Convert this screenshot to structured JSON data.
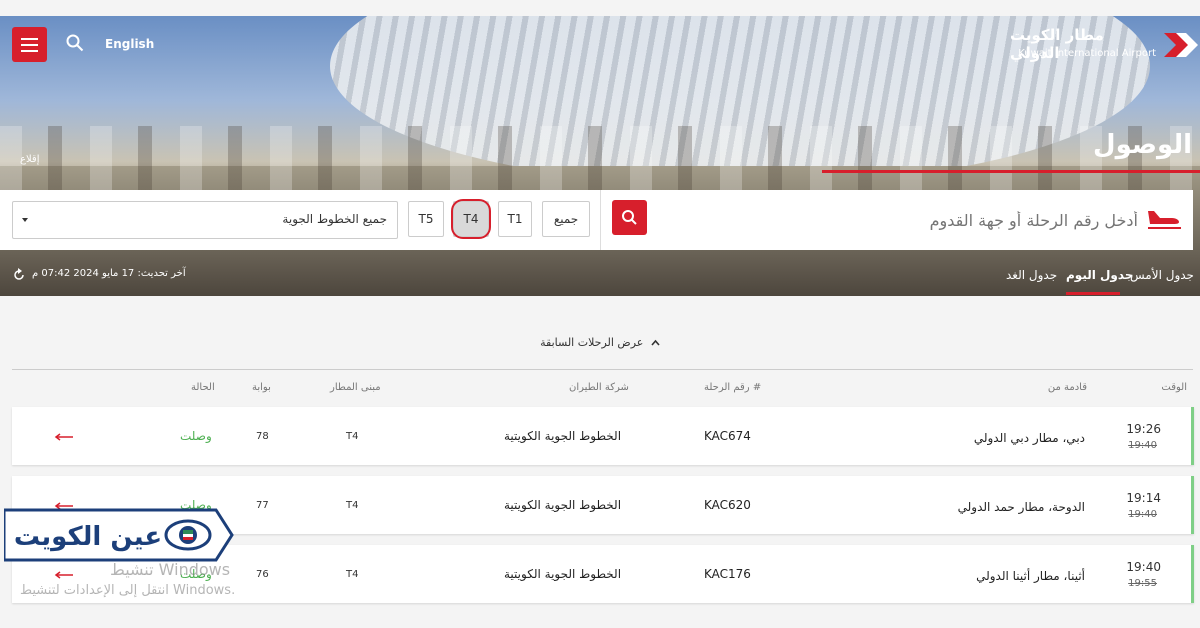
{
  "header": {
    "lang": "English",
    "logo_ar": "مطار الكويت الدولي",
    "logo_en": "Kuwait International Airport",
    "hero_tag": "إقلاع"
  },
  "page": {
    "title": "الوصول"
  },
  "search": {
    "placeholder": "أدخل رقم الرحلة أو جهة القدوم",
    "airline": "جميع الخطوط الجوية",
    "terminals": [
      "T5",
      "T4",
      "T1",
      "جميع"
    ],
    "selected": "T4"
  },
  "tabs": {
    "yesterday": "جدول الأمس",
    "today": "جدول اليوم",
    "tomorrow": "جدول الغد"
  },
  "update": "آخر تحديث: 17 مايو 2024 07:42 م",
  "prev": "عرض الرحلات السابقة",
  "columns": {
    "time": "الوقت",
    "from": "قادمة من",
    "flight": "رقم الرحلة #",
    "airline": "شركة الطيران",
    "terminal": "مبنى المطار",
    "gate": "بوابة",
    "status": "الحالة"
  },
  "flights": [
    {
      "time": "19:26",
      "sched": "19:40",
      "from": "دبي، مطار دبي الدولي",
      "flight": "KAC674",
      "airline": "الخطوط الجوية الكويتية",
      "terminal": "T4",
      "gate": "78",
      "status": "وصلت"
    },
    {
      "time": "19:14",
      "sched": "19:40",
      "from": "الدوحة، مطار حمد الدولي",
      "flight": "KAC620",
      "airline": "الخطوط الجوية الكويتية",
      "terminal": "T4",
      "gate": "77",
      "status": "وصلت"
    },
    {
      "time": "19:40",
      "sched": "19:55",
      "from": "أثينا، مطار أثينا الدولي",
      "flight": "KAC176",
      "airline": "الخطوط الجوية الكويتية",
      "terminal": "T4",
      "gate": "76",
      "status": "وصلت"
    }
  ],
  "watermark": {
    "logo_text": "عين الكويت",
    "activate_title": "تنشيط Windows",
    "activate_sub": "انتقل إلى الإعدادات لتنشيط Windows."
  },
  "colors": {
    "accent": "#d71f2c",
    "status_green": "#4caf50"
  }
}
